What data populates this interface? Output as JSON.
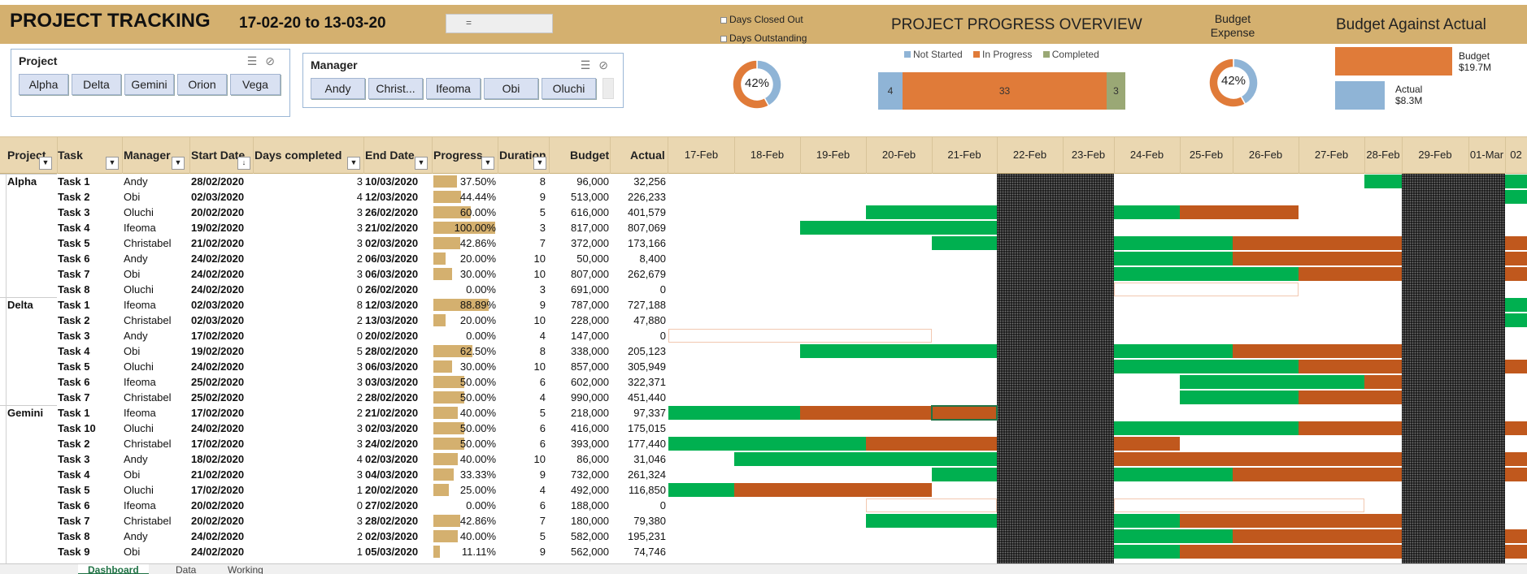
{
  "header": {
    "title": "PROJECT TRACKING",
    "date_range": "17-02-20 to 13-03-20",
    "timeline_control": "=",
    "legend_closed": "Days Closed Out",
    "legend_outstanding": "Days Outstanding",
    "overview_title": "PROJECT PROGRESS OVERVIEW",
    "budget_expense": "Budget Expense",
    "budget_actual_title": "Budget Against Actual"
  },
  "slicers": {
    "project": {
      "title": "Project",
      "items": [
        "Alpha",
        "Delta",
        "Gemini",
        "Orion",
        "Vega"
      ]
    },
    "manager": {
      "title": "Manager",
      "items": [
        "Andy",
        "Christ...",
        "Ifeoma",
        "Obi",
        "Oluchi"
      ]
    }
  },
  "charts": {
    "days_donut": {
      "label": "42%",
      "percent": 42,
      "colors": {
        "main": "#e07b39",
        "rest": "#8fb4d6"
      }
    },
    "progress_overview": {
      "legend": [
        "Not Started",
        "In Progress",
        "Completed"
      ],
      "colors": [
        "#8fb4d6",
        "#e07b39",
        "#9aa875"
      ],
      "values": [
        4,
        33,
        3
      ],
      "labels": [
        "4",
        "33",
        "3"
      ]
    },
    "budget_donut": {
      "label": "42%",
      "percent": 42
    },
    "budget_vs_actual": {
      "budget_label": "Budget",
      "budget_value": "$19.7M",
      "budget_amount": 19.7,
      "actual_label": "Actual",
      "actual_value": "$8.3M",
      "actual_amount": 8.3,
      "colors": {
        "budget": "#e07b39",
        "actual": "#8fb4d6"
      }
    }
  },
  "table": {
    "columns": {
      "project": "Project",
      "task": "Task",
      "manager": "Manager",
      "start": "Start Date",
      "days_completed": "Days completed",
      "end": "End Date",
      "progress": "Progress",
      "duration": "Duration",
      "budget": "Budget",
      "actual": "Actual"
    },
    "dates": [
      "17-Feb",
      "18-Feb",
      "19-Feb",
      "20-Feb",
      "21-Feb",
      "22-Feb",
      "23-Feb",
      "24-Feb",
      "25-Feb",
      "26-Feb",
      "27-Feb",
      "28-Feb",
      "29-Feb",
      "01-Mar",
      "02"
    ],
    "rows": [
      {
        "project": "Alpha",
        "task": "Task 1",
        "manager": "Andy",
        "start": "28/02/2020",
        "days": "3",
        "end": "10/03/2020",
        "progress": "37.50%",
        "pct": 0.375,
        "duration": "8",
        "budget": "96,000",
        "actual": "32,256"
      },
      {
        "project": "",
        "task": "Task 2",
        "manager": "Obi",
        "start": "02/03/2020",
        "days": "4",
        "end": "12/03/2020",
        "progress": "44.44%",
        "pct": 0.4444,
        "duration": "9",
        "budget": "513,000",
        "actual": "226,233"
      },
      {
        "project": "",
        "task": "Task 3",
        "manager": "Oluchi",
        "start": "20/02/2020",
        "days": "3",
        "end": "26/02/2020",
        "progress": "60.00%",
        "pct": 0.6,
        "duration": "5",
        "budget": "616,000",
        "actual": "401,579"
      },
      {
        "project": "",
        "task": "Task 4",
        "manager": "Ifeoma",
        "start": "19/02/2020",
        "days": "3",
        "end": "21/02/2020",
        "progress": "100.00%",
        "pct": 1.0,
        "duration": "3",
        "budget": "817,000",
        "actual": "807,069"
      },
      {
        "project": "",
        "task": "Task 5",
        "manager": "Christabel",
        "start": "21/02/2020",
        "days": "3",
        "end": "02/03/2020",
        "progress": "42.86%",
        "pct": 0.4286,
        "duration": "7",
        "budget": "372,000",
        "actual": "173,166"
      },
      {
        "project": "",
        "task": "Task 6",
        "manager": "Andy",
        "start": "24/02/2020",
        "days": "2",
        "end": "06/03/2020",
        "progress": "20.00%",
        "pct": 0.2,
        "duration": "10",
        "budget": "50,000",
        "actual": "8,400"
      },
      {
        "project": "",
        "task": "Task 7",
        "manager": "Obi",
        "start": "24/02/2020",
        "days": "3",
        "end": "06/03/2020",
        "progress": "30.00%",
        "pct": 0.3,
        "duration": "10",
        "budget": "807,000",
        "actual": "262,679"
      },
      {
        "project": "",
        "task": "Task 8",
        "manager": "Oluchi",
        "start": "24/02/2020",
        "days": "0",
        "end": "26/02/2020",
        "progress": "0.00%",
        "pct": 0,
        "duration": "3",
        "budget": "691,000",
        "actual": "0"
      },
      {
        "project": "Delta",
        "task": "Task 1",
        "manager": "Ifeoma",
        "start": "02/03/2020",
        "days": "8",
        "end": "12/03/2020",
        "progress": "88.89%",
        "pct": 0.8889,
        "duration": "9",
        "budget": "787,000",
        "actual": "727,188"
      },
      {
        "project": "",
        "task": "Task 2",
        "manager": "Christabel",
        "start": "02/03/2020",
        "days": "2",
        "end": "13/03/2020",
        "progress": "20.00%",
        "pct": 0.2,
        "duration": "10",
        "budget": "228,000",
        "actual": "47,880"
      },
      {
        "project": "",
        "task": "Task 3",
        "manager": "Andy",
        "start": "17/02/2020",
        "days": "0",
        "end": "20/02/2020",
        "progress": "0.00%",
        "pct": 0,
        "duration": "4",
        "budget": "147,000",
        "actual": "0"
      },
      {
        "project": "",
        "task": "Task 4",
        "manager": "Obi",
        "start": "19/02/2020",
        "days": "5",
        "end": "28/02/2020",
        "progress": "62.50%",
        "pct": 0.625,
        "duration": "8",
        "budget": "338,000",
        "actual": "205,123"
      },
      {
        "project": "",
        "task": "Task 5",
        "manager": "Oluchi",
        "start": "24/02/2020",
        "days": "3",
        "end": "06/03/2020",
        "progress": "30.00%",
        "pct": 0.3,
        "duration": "10",
        "budget": "857,000",
        "actual": "305,949"
      },
      {
        "project": "",
        "task": "Task 6",
        "manager": "Ifeoma",
        "start": "25/02/2020",
        "days": "3",
        "end": "03/03/2020",
        "progress": "50.00%",
        "pct": 0.5,
        "duration": "6",
        "budget": "602,000",
        "actual": "322,371"
      },
      {
        "project": "",
        "task": "Task 7",
        "manager": "Christabel",
        "start": "25/02/2020",
        "days": "2",
        "end": "28/02/2020",
        "progress": "50.00%",
        "pct": 0.5,
        "duration": "4",
        "budget": "990,000",
        "actual": "451,440"
      },
      {
        "project": "Gemini",
        "task": "Task 1",
        "manager": "Ifeoma",
        "start": "17/02/2020",
        "days": "2",
        "end": "21/02/2020",
        "progress": "40.00%",
        "pct": 0.4,
        "duration": "5",
        "budget": "218,000",
        "actual": "97,337"
      },
      {
        "project": "",
        "task": "Task 10",
        "manager": "Oluchi",
        "start": "24/02/2020",
        "days": "3",
        "end": "02/03/2020",
        "progress": "50.00%",
        "pct": 0.5,
        "duration": "6",
        "budget": "416,000",
        "actual": "175,015"
      },
      {
        "project": "",
        "task": "Task 2",
        "manager": "Christabel",
        "start": "17/02/2020",
        "days": "3",
        "end": "24/02/2020",
        "progress": "50.00%",
        "pct": 0.5,
        "duration": "6",
        "budget": "393,000",
        "actual": "177,440"
      },
      {
        "project": "",
        "task": "Task 3",
        "manager": "Andy",
        "start": "18/02/2020",
        "days": "4",
        "end": "02/03/2020",
        "progress": "40.00%",
        "pct": 0.4,
        "duration": "10",
        "budget": "86,000",
        "actual": "31,046"
      },
      {
        "project": "",
        "task": "Task 4",
        "manager": "Obi",
        "start": "21/02/2020",
        "days": "3",
        "end": "04/03/2020",
        "progress": "33.33%",
        "pct": 0.3333,
        "duration": "9",
        "budget": "732,000",
        "actual": "261,324"
      },
      {
        "project": "",
        "task": "Task 5",
        "manager": "Oluchi",
        "start": "17/02/2020",
        "days": "1",
        "end": "20/02/2020",
        "progress": "25.00%",
        "pct": 0.25,
        "duration": "4",
        "budget": "492,000",
        "actual": "116,850"
      },
      {
        "project": "",
        "task": "Task 6",
        "manager": "Ifeoma",
        "start": "20/02/2020",
        "days": "0",
        "end": "27/02/2020",
        "progress": "0.00%",
        "pct": 0,
        "duration": "6",
        "budget": "188,000",
        "actual": "0"
      },
      {
        "project": "",
        "task": "Task 7",
        "manager": "Christabel",
        "start": "20/02/2020",
        "days": "3",
        "end": "28/02/2020",
        "progress": "42.86%",
        "pct": 0.4286,
        "duration": "7",
        "budget": "180,000",
        "actual": "79,380"
      },
      {
        "project": "",
        "task": "Task 8",
        "manager": "Andy",
        "start": "24/02/2020",
        "days": "2",
        "end": "02/03/2020",
        "progress": "40.00%",
        "pct": 0.4,
        "duration": "5",
        "budget": "582,000",
        "actual": "195,231"
      },
      {
        "project": "",
        "task": "Task 9",
        "manager": "Obi",
        "start": "24/02/2020",
        "days": "1",
        "end": "05/03/2020",
        "progress": "11.11%",
        "pct": 0.1111,
        "duration": "9",
        "budget": "562,000",
        "actual": "74,746"
      }
    ]
  },
  "gantt": [
    [
      {
        "from": "28-Feb",
        "to": "28-Feb",
        "status": "closed"
      },
      {
        "from": "02",
        "to": "02",
        "status": "closed"
      }
    ],
    [
      {
        "from": "02",
        "to": "02",
        "status": "closed"
      }
    ],
    [
      {
        "from": "20-Feb",
        "to": "21-Feb",
        "status": "closed"
      },
      {
        "from": "24-Feb",
        "to": "24-Feb",
        "status": "closed"
      },
      {
        "from": "25-Feb",
        "to": "26-Feb",
        "status": "outstanding"
      }
    ],
    [
      {
        "from": "19-Feb",
        "to": "21-Feb",
        "status": "closed"
      }
    ],
    [
      {
        "from": "21-Feb",
        "to": "21-Feb",
        "status": "closed"
      },
      {
        "from": "24-Feb",
        "to": "25-Feb",
        "status": "closed"
      },
      {
        "from": "26-Feb",
        "to": "28-Feb",
        "status": "outstanding"
      },
      {
        "from": "02",
        "to": "02",
        "status": "outstanding"
      }
    ],
    [
      {
        "from": "24-Feb",
        "to": "25-Feb",
        "status": "closed"
      },
      {
        "from": "26-Feb",
        "to": "28-Feb",
        "status": "outstanding"
      },
      {
        "from": "02",
        "to": "02",
        "status": "outstanding"
      }
    ],
    [
      {
        "from": "24-Feb",
        "to": "26-Feb",
        "status": "closed"
      },
      {
        "from": "27-Feb",
        "to": "28-Feb",
        "status": "outstanding"
      },
      {
        "from": "02",
        "to": "02",
        "status": "outstanding"
      }
    ],
    [
      {
        "from": "24-Feb",
        "to": "26-Feb",
        "status": "empty"
      }
    ],
    [
      {
        "from": "02",
        "to": "02",
        "status": "closed"
      }
    ],
    [
      {
        "from": "02",
        "to": "02",
        "status": "closed"
      }
    ],
    [
      {
        "from": "17-Feb",
        "to": "20-Feb",
        "status": "empty"
      }
    ],
    [
      {
        "from": "19-Feb",
        "to": "21-Feb",
        "status": "closed"
      },
      {
        "from": "24-Feb",
        "to": "25-Feb",
        "status": "closed"
      },
      {
        "from": "26-Feb",
        "to": "28-Feb",
        "status": "outstanding"
      }
    ],
    [
      {
        "from": "24-Feb",
        "to": "26-Feb",
        "status": "closed"
      },
      {
        "from": "27-Feb",
        "to": "28-Feb",
        "status": "outstanding"
      },
      {
        "from": "02",
        "to": "02",
        "status": "outstanding"
      }
    ],
    [
      {
        "from": "25-Feb",
        "to": "27-Feb",
        "status": "closed"
      },
      {
        "from": "28-Feb",
        "to": "28-Feb",
        "status": "outstanding"
      }
    ],
    [
      {
        "from": "25-Feb",
        "to": "26-Feb",
        "status": "closed"
      },
      {
        "from": "27-Feb",
        "to": "28-Feb",
        "status": "outstanding"
      }
    ],
    [
      {
        "from": "17-Feb",
        "to": "18-Feb",
        "status": "closed"
      },
      {
        "from": "19-Feb",
        "to": "20-Feb",
        "status": "outstanding"
      },
      {
        "from": "21-Feb",
        "to": "21-Feb",
        "status": "outstanding",
        "selected": true
      }
    ],
    [
      {
        "from": "24-Feb",
        "to": "26-Feb",
        "status": "closed"
      },
      {
        "from": "27-Feb",
        "to": "28-Feb",
        "status": "outstanding"
      },
      {
        "from": "02",
        "to": "02",
        "status": "outstanding"
      }
    ],
    [
      {
        "from": "17-Feb",
        "to": "19-Feb",
        "status": "closed"
      },
      {
        "from": "20-Feb",
        "to": "21-Feb",
        "status": "outstanding"
      },
      {
        "from": "24-Feb",
        "to": "24-Feb",
        "status": "outstanding"
      }
    ],
    [
      {
        "from": "18-Feb",
        "to": "21-Feb",
        "status": "closed"
      },
      {
        "from": "24-Feb",
        "to": "28-Feb",
        "status": "outstanding"
      },
      {
        "from": "02",
        "to": "02",
        "status": "outstanding"
      }
    ],
    [
      {
        "from": "21-Feb",
        "to": "21-Feb",
        "status": "closed"
      },
      {
        "from": "24-Feb",
        "to": "25-Feb",
        "status": "closed"
      },
      {
        "from": "26-Feb",
        "to": "28-Feb",
        "status": "outstanding"
      },
      {
        "from": "02",
        "to": "02",
        "status": "outstanding"
      }
    ],
    [
      {
        "from": "17-Feb",
        "to": "17-Feb",
        "status": "closed"
      },
      {
        "from": "18-Feb",
        "to": "20-Feb",
        "status": "outstanding"
      }
    ],
    [
      {
        "from": "20-Feb",
        "to": "21-Feb",
        "status": "empty"
      },
      {
        "from": "24-Feb",
        "to": "27-Feb",
        "status": "empty"
      }
    ],
    [
      {
        "from": "20-Feb",
        "to": "21-Feb",
        "status": "closed"
      },
      {
        "from": "24-Feb",
        "to": "24-Feb",
        "status": "closed"
      },
      {
        "from": "25-Feb",
        "to": "28-Feb",
        "status": "outstanding"
      }
    ],
    [
      {
        "from": "24-Feb",
        "to": "25-Feb",
        "status": "closed"
      },
      {
        "from": "26-Feb",
        "to": "28-Feb",
        "status": "outstanding"
      },
      {
        "from": "02",
        "to": "02",
        "status": "outstanding"
      }
    ],
    [
      {
        "from": "24-Feb",
        "to": "24-Feb",
        "status": "closed"
      },
      {
        "from": "25-Feb",
        "to": "28-Feb",
        "status": "outstanding"
      },
      {
        "from": "02",
        "to": "02",
        "status": "outstanding"
      }
    ]
  ],
  "tabs": [
    "Dashboard",
    "Data",
    "Working"
  ],
  "colors": {
    "gold": "#d4b06f",
    "header_fill": "#ead7b1",
    "closed": "#00b050",
    "outstanding": "#c0581d"
  }
}
